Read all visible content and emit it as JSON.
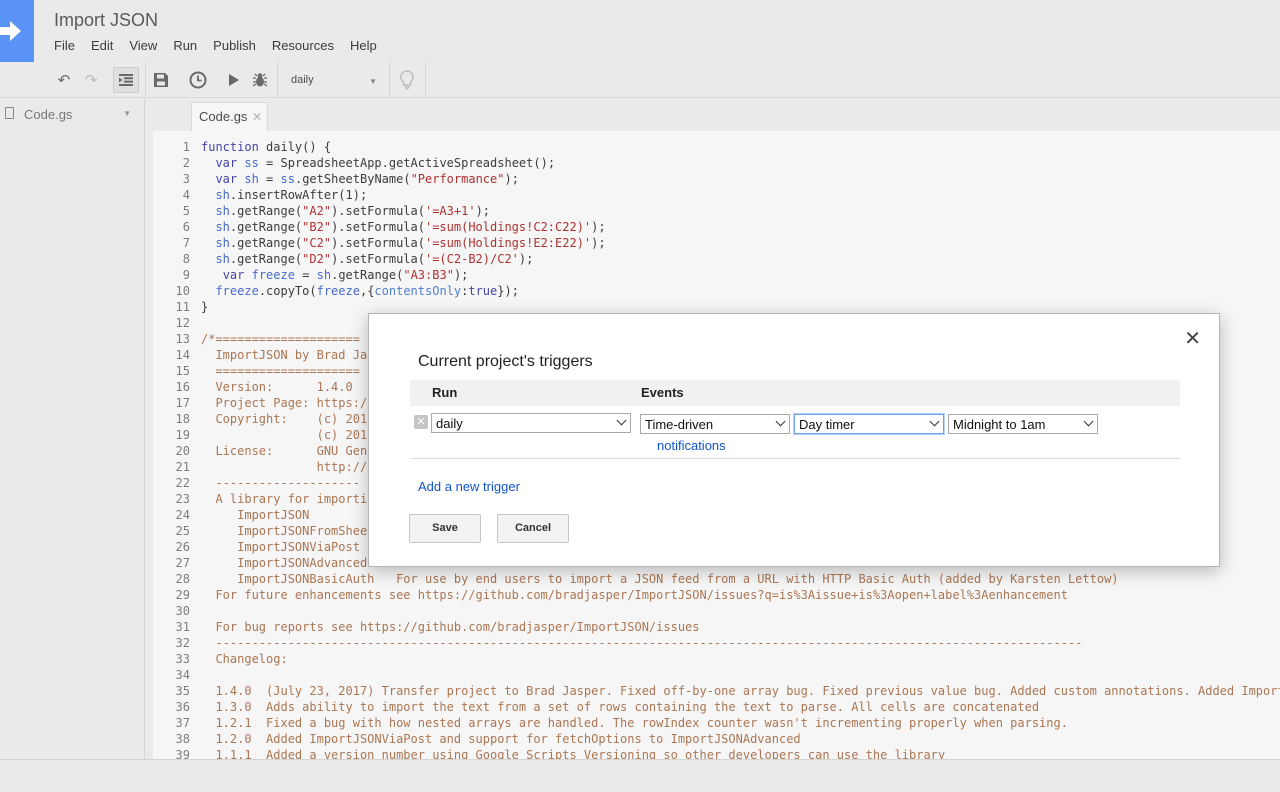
{
  "app": {
    "title": "Import JSON",
    "brand_color": "#4285f4",
    "logo_icon": "arrow-right-icon"
  },
  "menu": [
    "File",
    "Edit",
    "View",
    "Run",
    "Publish",
    "Resources",
    "Help"
  ],
  "toolbar": {
    "icons": [
      "undo-icon",
      "redo-icon",
      "indent-icon",
      "save-icon",
      "triggers-clock-icon",
      "run-icon",
      "debug-icon",
      "lightbulb-icon"
    ],
    "function_select": "daily"
  },
  "sidebar": {
    "file": "Code.gs"
  },
  "editor": {
    "tab": "Code.gs",
    "line_numbers": [
      "1",
      "2",
      "3",
      "4",
      "5",
      "6",
      "7",
      "8",
      "9",
      "10",
      "11",
      "12",
      "13",
      "14",
      "15",
      "16",
      "17",
      "18",
      "19",
      "20",
      "21",
      "22",
      "23",
      "24",
      "25",
      "26",
      "27",
      "28",
      "29",
      "30",
      "31",
      "32",
      "33",
      "34",
      "35",
      "36",
      "37",
      "38",
      "39"
    ],
    "lines": [
      "function daily() {",
      "  var ss = SpreadsheetApp.getActiveSpreadsheet();",
      "  var sh = ss.getSheetByName(\"Performance\");",
      "  sh.insertRowAfter(1);",
      "  sh.getRange(\"A2\").setFormula('=A3+1');",
      "  sh.getRange(\"B2\").setFormula('=sum(Holdings!C2:C22)');",
      "  sh.getRange(\"C2\").setFormula('=sum(Holdings!E2:E22)');",
      "  sh.getRange(\"D2\").setFormula('=(C2-B2)/C2');",
      "   var freeze = sh.getRange(\"A3:B3\");",
      "  freeze.copyTo(freeze,{contentsOnly:true});",
      "}",
      "",
      "/*====================",
      "  ImportJSON by Brad Ja",
      "  ====================",
      "  Version:      1.4.0",
      "  Project Page: https:/",
      "  Copyright:    (c) 201",
      "                (c) 201",
      "  License:      GNU Gen",
      "                http://",
      "  --------------------",
      "  A library for importin",
      "     ImportJSON",
      "     ImportJSONFromShee",
      "     ImportJSONViaPost",
      "     ImportJSONAdvanced",
      "     ImportJSONBasicAuth   For use by end users to import a JSON feed from a URL with HTTP Basic Auth (added by Karsten Lettow)",
      "  For future enhancements see https://github.com/bradjasper/ImportJSON/issues?q=is%3Aissue+is%3Aopen+label%3Aenhancement",
      "",
      "  For bug reports see https://github.com/bradjasper/ImportJSON/issues",
      "  ------------------------------------------------------------------------------------------------------------------------",
      "  Changelog:",
      "",
      "  1.4.0  (July 23, 2017) Transfer project to Brad Jasper. Fixed off-by-one array bug. Fixed previous value bug. Added custom annotations. Added Import",
      "  1.3.0  Adds ability to import the text from a set of rows containing the text to parse. All cells are concatenated",
      "  1.2.1  Fixed a bug with how nested arrays are handled. The rowIndex counter wasn't incrementing properly when parsing.",
      "  1.2.0  Added ImportJSONViaPost and support for fetchOptions to ImportJSONAdvanced",
      "  1.1.1  Added a version number using Google Scripts Versioning so other developers can use the library"
    ]
  },
  "dialog": {
    "title": "Current project's triggers",
    "close_icon": "close-icon",
    "col_run": "Run",
    "col_events": "Events",
    "trigger": {
      "function": "daily",
      "event_source": "Time-driven",
      "timer_type": "Day timer",
      "time_of_day": "Midnight to 1am",
      "notifications_link": "notifications"
    },
    "add_trigger_link": "Add a new trigger",
    "save_label": "Save",
    "cancel_label": "Cancel"
  }
}
